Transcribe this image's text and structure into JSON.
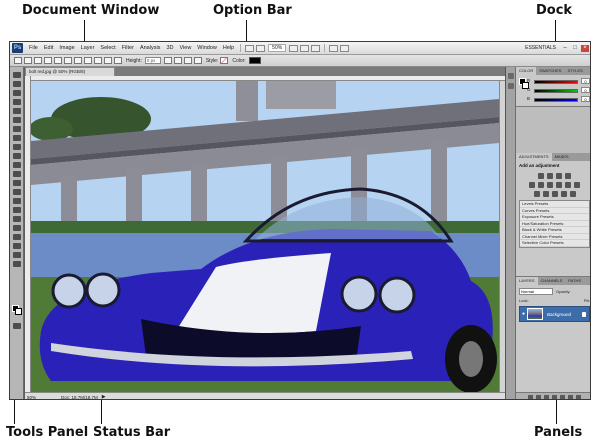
{
  "callouts": {
    "document_window": "Document Window",
    "option_bar": "Option Bar",
    "dock": "Dock",
    "tools_panel": "Tools Panel",
    "status_bar": "Status Bar",
    "panels": "Panels"
  },
  "app": {
    "logo": "Ps",
    "menu": [
      "File",
      "Edit",
      "Image",
      "Layer",
      "Select",
      "Filter",
      "Analysis",
      "3D",
      "View",
      "Window",
      "Help"
    ],
    "zoom": "50%",
    "workspace": "ESSENTIALS",
    "window_buttons": [
      "–",
      "□",
      "×"
    ]
  },
  "options_bar": {
    "height_label": "Height:",
    "height_value": "0 px",
    "style_label": "Style:",
    "color_label": "Color:",
    "color_value": "#000000"
  },
  "document": {
    "tab_title": "bolt red.jpg @ 50% (RGB/8)",
    "status_zoom": "50%",
    "status_doc": "Doc: 18.7M/18.7M"
  },
  "panels": {
    "color_tabs": [
      "Color",
      "Swatches",
      "Styles"
    ],
    "sliders": [
      {
        "label": "R",
        "value": "0"
      },
      {
        "label": "G",
        "value": "0"
      },
      {
        "label": "B",
        "value": "0"
      }
    ],
    "adjustment_tabs": [
      "Adjustments",
      "Masks"
    ],
    "adjustment_title": "Add an adjustment",
    "presets": [
      "Levels Presets",
      "Curves Presets",
      "Exposure Presets",
      "Hue/Saturation Presets",
      "Black & White Presets",
      "Channel Mixer Presets",
      "Selective Color Presets"
    ],
    "layer_tabs": [
      "Layers",
      "Channels",
      "Paths"
    ],
    "blend_mode": "Normal",
    "opacity_label": "Opacity:",
    "lock_label": "Lock:",
    "fill_label": "Fill:",
    "layer_name": "Background"
  },
  "colors": {
    "sky": "#b6d3f1",
    "bridge": "#7b7c86",
    "water": "#6c8cc8",
    "car_body": "#2a22b8",
    "stripe": "#f0f2f6",
    "grass": "#4f7b37",
    "panel_bg": "#c9c9c9"
  }
}
